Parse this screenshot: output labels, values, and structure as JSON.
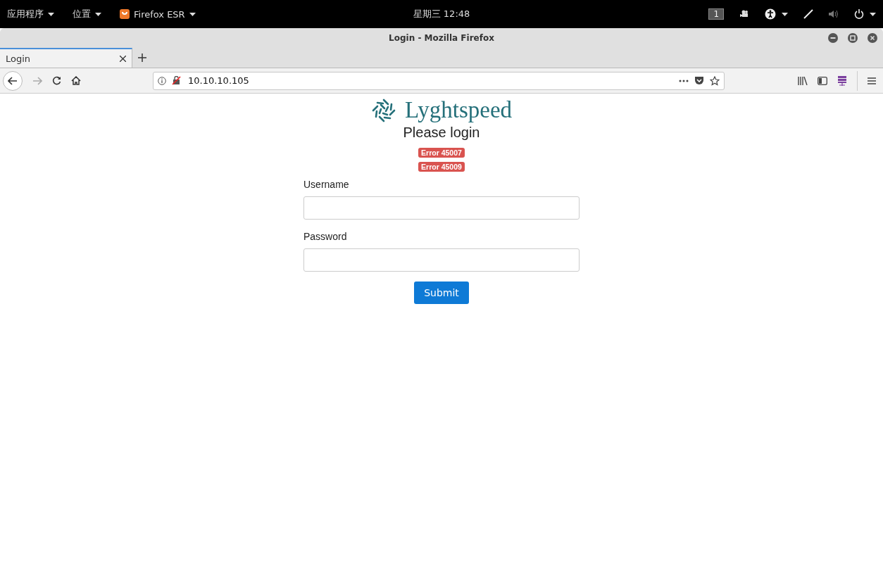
{
  "top_bar": {
    "menus": [
      {
        "label": "应用程序",
        "kind": "menu"
      },
      {
        "label": "位置",
        "kind": "menu"
      },
      {
        "label": "Firefox ESR",
        "kind": "app"
      }
    ],
    "clock": "星期三 12:48",
    "workspace": "1"
  },
  "window": {
    "title": "Login - Mozilla Firefox"
  },
  "tabs": [
    {
      "label": "Login",
      "selected": true
    }
  ],
  "address_bar": {
    "url": "10.10.10.105"
  },
  "page": {
    "logo_text": "Lyghtspeed",
    "heading": "Please login",
    "errors": [
      "Error 45007",
      "Error 45009"
    ],
    "fields": [
      {
        "label": "Username"
      },
      {
        "label": "Password"
      }
    ],
    "submit": "Submit"
  }
}
